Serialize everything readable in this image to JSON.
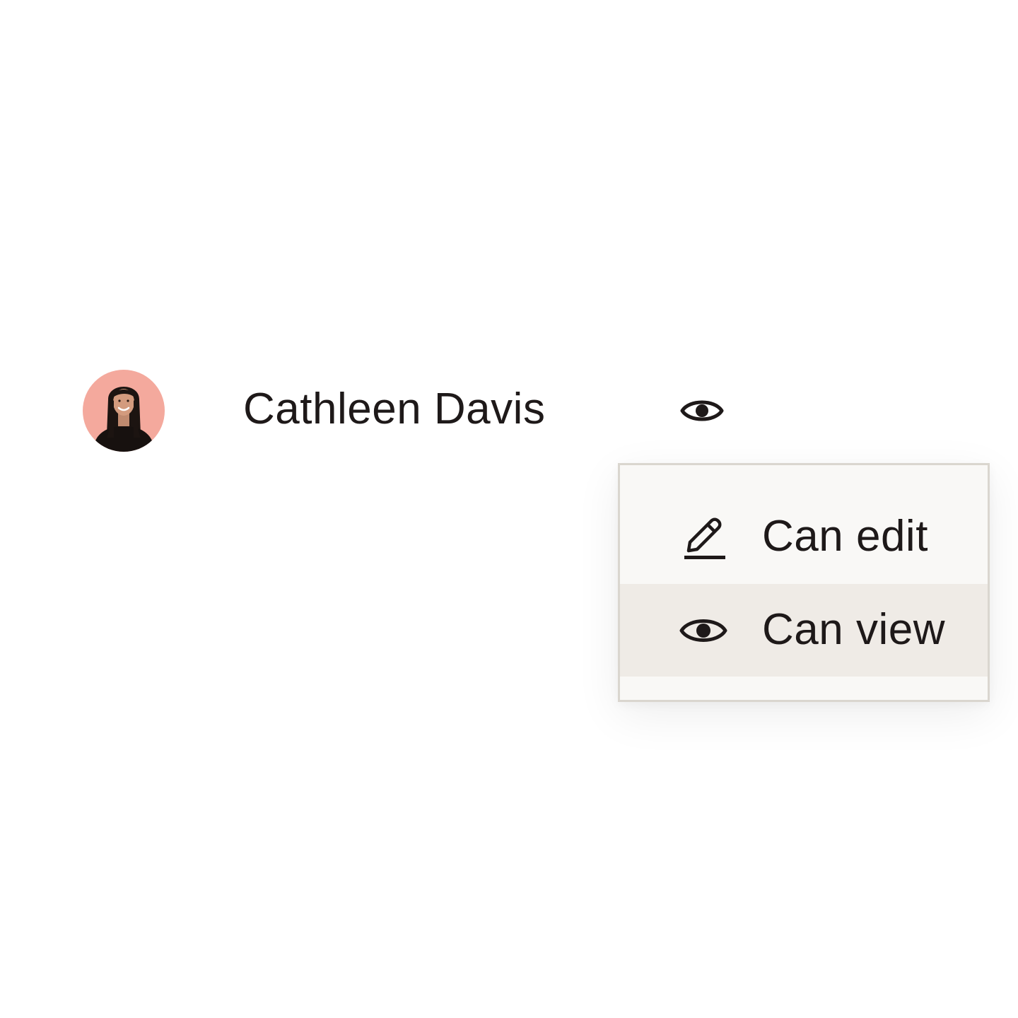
{
  "user": {
    "name": "Cathleen Davis",
    "avatar_icon": "profile-photo",
    "avatar_bg": "#f4a99d",
    "current_permission_icon": "eye-icon"
  },
  "permission_menu": {
    "items": [
      {
        "label": "Can edit",
        "icon": "pencil-icon",
        "selected": false
      },
      {
        "label": "Can view",
        "icon": "eye-icon",
        "selected": true
      }
    ],
    "highlight_color": "#efebe6",
    "background_color": "#f9f8f6"
  }
}
